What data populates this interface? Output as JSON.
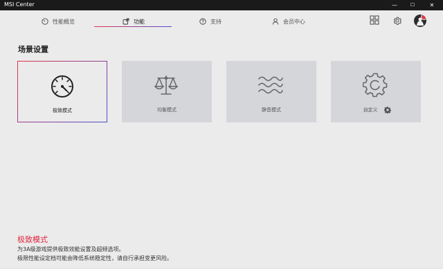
{
  "window": {
    "title": "MSI Center",
    "minimize": "—",
    "maximize": "☐",
    "close": "✕"
  },
  "nav": {
    "tabs": [
      {
        "label": "性能概览",
        "icon": "gauge-icon"
      },
      {
        "label": "功能",
        "icon": "external-box-icon",
        "active": true
      },
      {
        "label": "支持",
        "icon": "question-circle-icon"
      },
      {
        "label": "会员中心",
        "icon": "user-icon"
      }
    ],
    "accent_gradient": [
      "#e2334a",
      "#4a4ad0"
    ]
  },
  "header_icons": [
    "grid-icon",
    "gear-icon",
    "avatar"
  ],
  "section": {
    "title": "场景设置"
  },
  "modes": [
    {
      "label": "极致模式",
      "icon": "speedometer-icon",
      "selected": true
    },
    {
      "label": "均衡模式",
      "icon": "balance-scale-icon",
      "selected": false
    },
    {
      "label": "静音模式",
      "icon": "waves-icon",
      "selected": false
    },
    {
      "label": "自定义",
      "icon": "gear-icon",
      "selected": false
    }
  ],
  "description": {
    "title": "极致模式",
    "line1": "为3A级游戏提供极致效能设置及超频选项。",
    "line2": "极限性能设定档可能会降低系统稳定性，请自行承担变更风险。"
  },
  "colors": {
    "accent_red": "#e0263f",
    "card_bg": "#d4d6da",
    "page_bg": "#ebebeb"
  }
}
